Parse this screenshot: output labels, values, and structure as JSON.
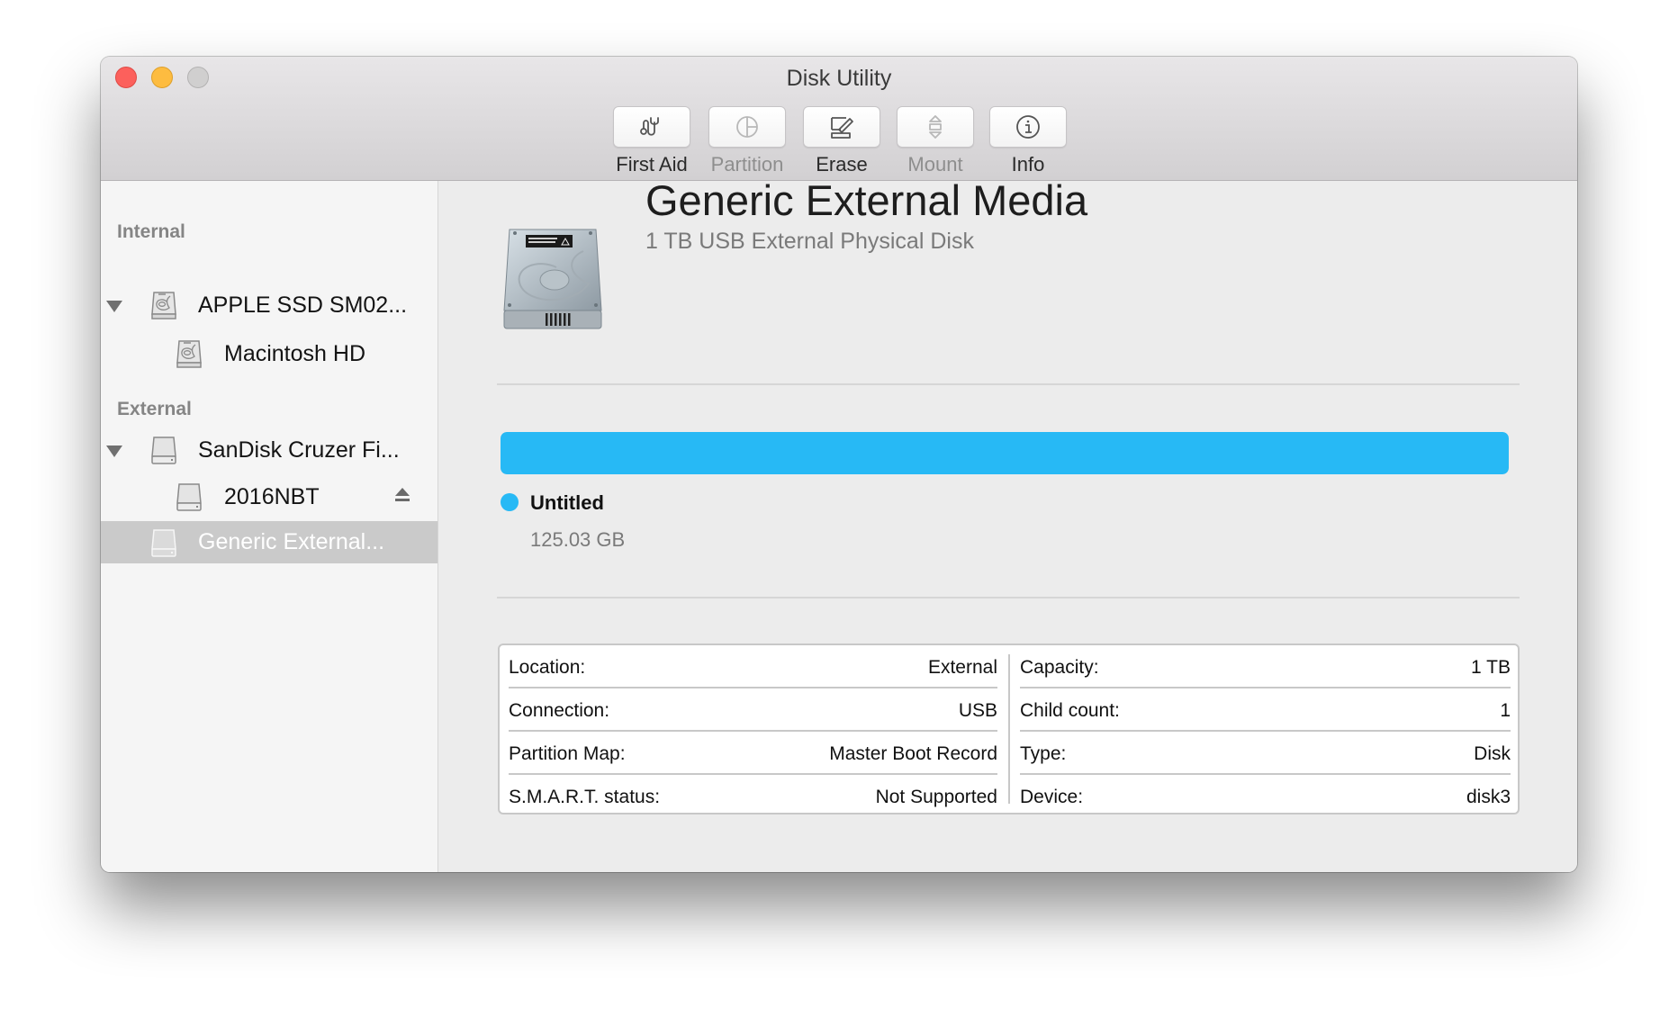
{
  "window": {
    "title": "Disk Utility",
    "traffic_lights": [
      "close",
      "minimize",
      "zoom"
    ]
  },
  "toolbar": {
    "buttons": [
      {
        "label": "First Aid",
        "icon": "stethoscope-icon",
        "enabled": true
      },
      {
        "label": "Partition",
        "icon": "pie-partition-icon",
        "enabled": false
      },
      {
        "label": "Erase",
        "icon": "erase-icon",
        "enabled": true
      },
      {
        "label": "Mount",
        "icon": "mount-icon",
        "enabled": false
      },
      {
        "label": "Info",
        "icon": "info-icon",
        "enabled": true
      }
    ]
  },
  "sidebar": {
    "sections": [
      {
        "header": "Internal",
        "items": [
          {
            "label": "APPLE SSD SM02...",
            "icon": "internal-disk-icon",
            "expandable": true,
            "level": 0
          },
          {
            "label": "Macintosh HD",
            "icon": "internal-disk-icon",
            "expandable": false,
            "level": 1
          }
        ]
      },
      {
        "header": "External",
        "items": [
          {
            "label": "SanDisk Cruzer Fi...",
            "icon": "external-disk-icon",
            "expandable": true,
            "level": 0
          },
          {
            "label": "2016NBT",
            "icon": "external-disk-icon",
            "expandable": false,
            "level": 1,
            "ejectable": true
          },
          {
            "label": "Generic External...",
            "icon": "external-disk-icon",
            "expandable": false,
            "level": 0,
            "selected": true
          }
        ]
      }
    ]
  },
  "detail": {
    "name": "Generic External Media",
    "subtitle": "1 TB USB External Physical Disk",
    "usage": {
      "fill_fraction": 1.0,
      "color": "#27b9f5",
      "partitions": [
        {
          "name": "Untitled",
          "size": "125.03 GB",
          "color": "#27b9f5"
        }
      ]
    },
    "info_left": [
      {
        "label": "Location:",
        "value": "External"
      },
      {
        "label": "Connection:",
        "value": "USB"
      },
      {
        "label": "Partition Map:",
        "value": "Master Boot Record"
      },
      {
        "label": "S.M.A.R.T. status:",
        "value": "Not Supported"
      }
    ],
    "info_right": [
      {
        "label": "Capacity:",
        "value": "1 TB"
      },
      {
        "label": "Child count:",
        "value": "1"
      },
      {
        "label": "Type:",
        "value": "Disk"
      },
      {
        "label": "Device:",
        "value": "disk3"
      }
    ]
  }
}
